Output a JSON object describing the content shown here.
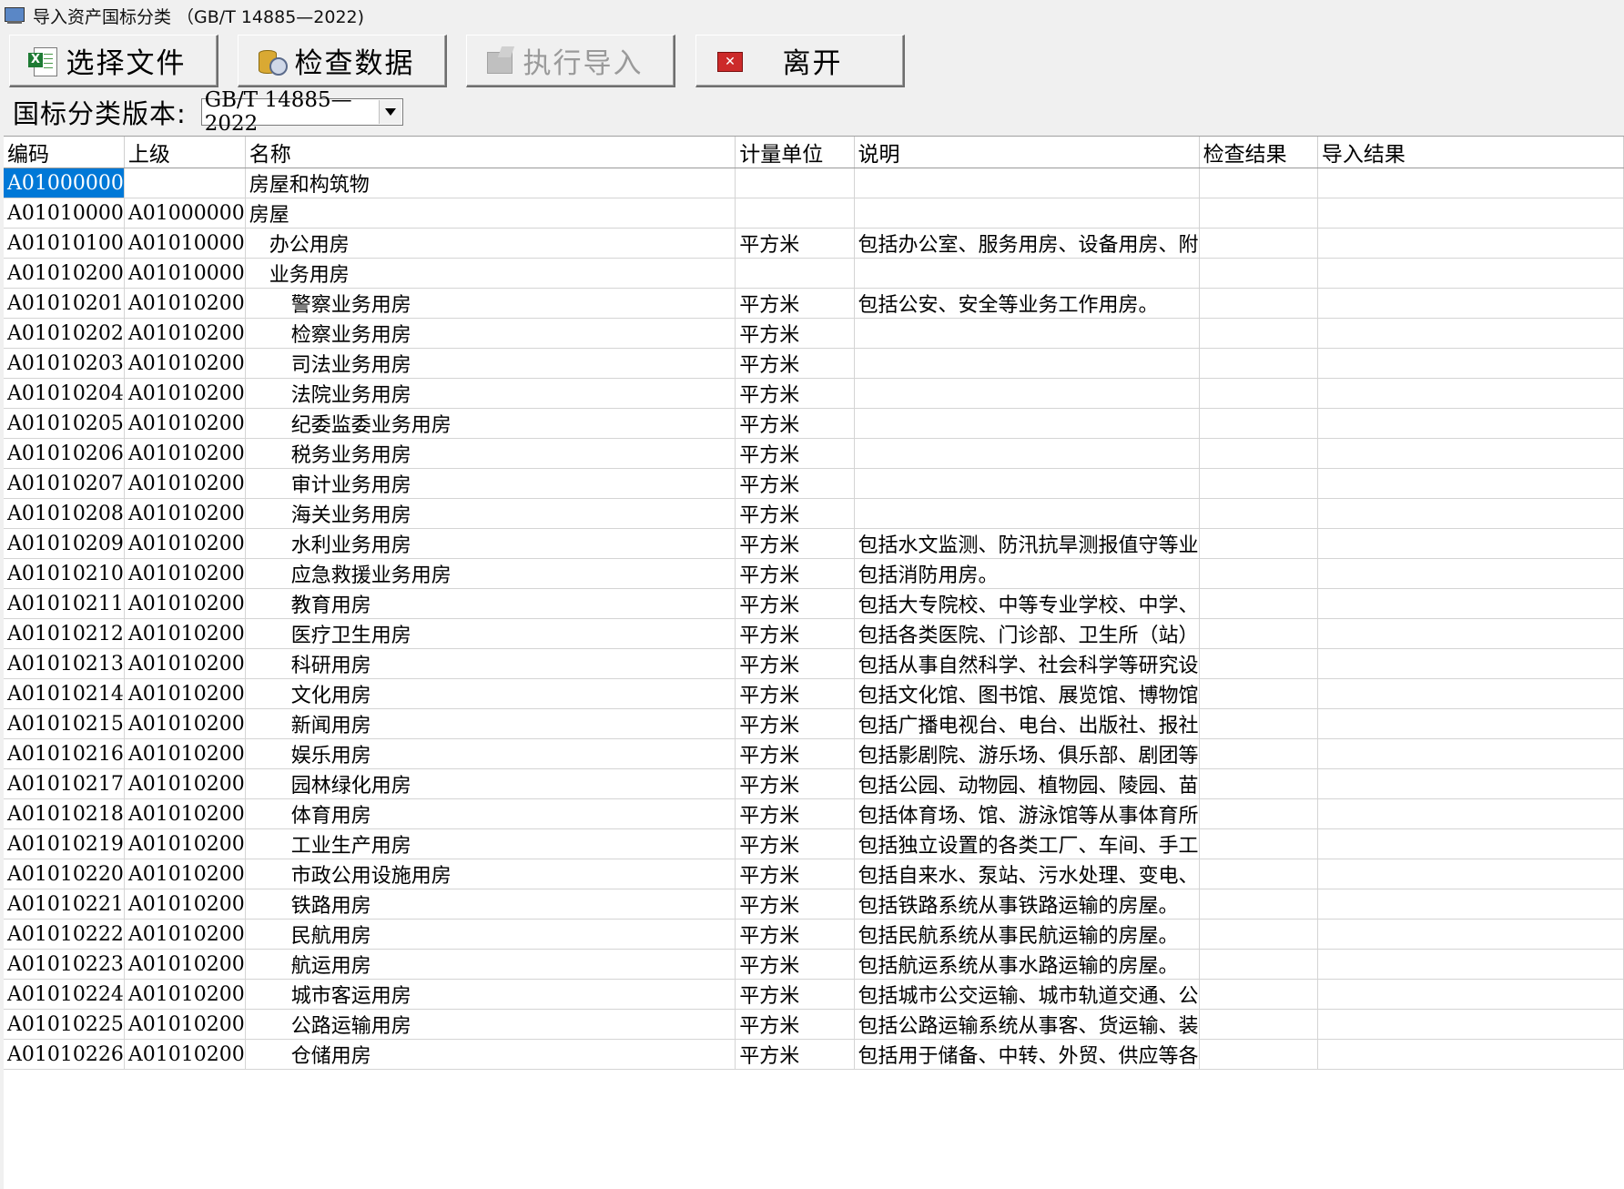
{
  "window": {
    "title": "导入资产国标分类 （GB/T 14885—2022)"
  },
  "toolbar": {
    "select_file": "选择文件",
    "check_data": "检查数据",
    "execute_import": "执行导入",
    "leave": "离开"
  },
  "version": {
    "label": "国标分类版本:",
    "selected": "GB/T 14885—2022"
  },
  "grid": {
    "columns": [
      "编码",
      "上级",
      "名称",
      "计量单位",
      "说明",
      "检查结果",
      "导入结果"
    ],
    "rows": [
      {
        "code": "A01000000",
        "parent": "",
        "name": "房屋和构筑物",
        "level": 0,
        "unit": "",
        "desc": ""
      },
      {
        "code": "A01010000",
        "parent": "A01000000",
        "name": "房屋",
        "level": 0,
        "unit": "",
        "desc": ""
      },
      {
        "code": "A01010100",
        "parent": "A01010000",
        "name": "办公用房",
        "level": 1,
        "unit": "平方米",
        "desc": "包括办公室、服务用房、设备用房、附"
      },
      {
        "code": "A01010200",
        "parent": "A01010000",
        "name": "业务用房",
        "level": 1,
        "unit": "",
        "desc": ""
      },
      {
        "code": "A01010201",
        "parent": "A01010200",
        "name": "警察业务用房",
        "level": 2,
        "unit": "平方米",
        "desc": "包括公安、安全等业务工作用房。"
      },
      {
        "code": "A01010202",
        "parent": "A01010200",
        "name": "检察业务用房",
        "level": 2,
        "unit": "平方米",
        "desc": ""
      },
      {
        "code": "A01010203",
        "parent": "A01010200",
        "name": "司法业务用房",
        "level": 2,
        "unit": "平方米",
        "desc": ""
      },
      {
        "code": "A01010204",
        "parent": "A01010200",
        "name": "法院业务用房",
        "level": 2,
        "unit": "平方米",
        "desc": ""
      },
      {
        "code": "A01010205",
        "parent": "A01010200",
        "name": "纪委监委业务用房",
        "level": 2,
        "unit": "平方米",
        "desc": ""
      },
      {
        "code": "A01010206",
        "parent": "A01010200",
        "name": "税务业务用房",
        "level": 2,
        "unit": "平方米",
        "desc": ""
      },
      {
        "code": "A01010207",
        "parent": "A01010200",
        "name": "审计业务用房",
        "level": 2,
        "unit": "平方米",
        "desc": ""
      },
      {
        "code": "A01010208",
        "parent": "A01010200",
        "name": "海关业务用房",
        "level": 2,
        "unit": "平方米",
        "desc": ""
      },
      {
        "code": "A01010209",
        "parent": "A01010200",
        "name": "水利业务用房",
        "level": 2,
        "unit": "平方米",
        "desc": "包括水文监测、防汛抗旱测报值守等业"
      },
      {
        "code": "A01010210",
        "parent": "A01010200",
        "name": "应急救援业务用房",
        "level": 2,
        "unit": "平方米",
        "desc": "包括消防用房。"
      },
      {
        "code": "A01010211",
        "parent": "A01010200",
        "name": "教育用房",
        "level": 2,
        "unit": "平方米",
        "desc": "包括大专院校、中等专业学校、中学、"
      },
      {
        "code": "A01010212",
        "parent": "A01010200",
        "name": "医疗卫生用房",
        "level": 2,
        "unit": "平方米",
        "desc": "包括各类医院、门诊部、卫生所（站）"
      },
      {
        "code": "A01010213",
        "parent": "A01010200",
        "name": "科研用房",
        "level": 2,
        "unit": "平方米",
        "desc": "包括从事自然科学、社会科学等研究设"
      },
      {
        "code": "A01010214",
        "parent": "A01010200",
        "name": "文化用房",
        "level": 2,
        "unit": "平方米",
        "desc": "包括文化馆、图书馆、展览馆、博物馆"
      },
      {
        "code": "A01010215",
        "parent": "A01010200",
        "name": "新闻用房",
        "level": 2,
        "unit": "平方米",
        "desc": "包括广播电视台、电台、出版社、报社"
      },
      {
        "code": "A01010216",
        "parent": "A01010200",
        "name": "娱乐用房",
        "level": 2,
        "unit": "平方米",
        "desc": "包括影剧院、游乐场、俱乐部、剧团等"
      },
      {
        "code": "A01010217",
        "parent": "A01010200",
        "name": "园林绿化用房",
        "level": 2,
        "unit": "平方米",
        "desc": "包括公园、动物园、植物园、陵园、苗"
      },
      {
        "code": "A01010218",
        "parent": "A01010200",
        "name": "体育用房",
        "level": 2,
        "unit": "平方米",
        "desc": "包括体育场、馆、游泳馆等从事体育所"
      },
      {
        "code": "A01010219",
        "parent": "A01010200",
        "name": "工业生产用房",
        "level": 2,
        "unit": "平方米",
        "desc": "包括独立设置的各类工厂、车间、手工"
      },
      {
        "code": "A01010220",
        "parent": "A01010200",
        "name": "市政公用设施用房",
        "level": 2,
        "unit": "平方米",
        "desc": "包括自来水、泵站、污水处理、变电、"
      },
      {
        "code": "A01010221",
        "parent": "A01010200",
        "name": "铁路用房",
        "level": 2,
        "unit": "平方米",
        "desc": "包括铁路系统从事铁路运输的房屋。"
      },
      {
        "code": "A01010222",
        "parent": "A01010200",
        "name": "民航用房",
        "level": 2,
        "unit": "平方米",
        "desc": "包括民航系统从事民航运输的房屋。"
      },
      {
        "code": "A01010223",
        "parent": "A01010200",
        "name": "航运用房",
        "level": 2,
        "unit": "平方米",
        "desc": "包括航运系统从事水路运输的房屋。"
      },
      {
        "code": "A01010224",
        "parent": "A01010200",
        "name": "城市客运用房",
        "level": 2,
        "unit": "平方米",
        "desc": "包括城市公交运输、城市轨道交通、公"
      },
      {
        "code": "A01010225",
        "parent": "A01010200",
        "name": "公路运输用房",
        "level": 2,
        "unit": "平方米",
        "desc": "包括公路运输系统从事客、货运输、装"
      },
      {
        "code": "A01010226",
        "parent": "A01010200",
        "name": "仓储用房",
        "level": 2,
        "unit": "平方米",
        "desc": "包括用于储备、中转、外贸、供应等各"
      }
    ]
  }
}
